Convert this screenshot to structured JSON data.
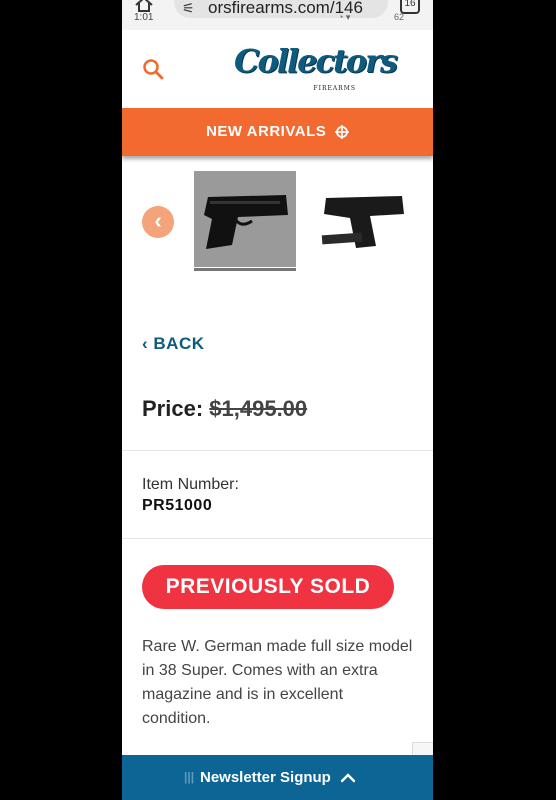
{
  "browser": {
    "url": "orsfirearms.com/146",
    "time": "1:01",
    "tab_count": "16",
    "battery": "62"
  },
  "header": {
    "logo_text": "Collectors",
    "logo_sub": "FIREARMS"
  },
  "nav": {
    "new_arrivals": "NEW ARRIVALS"
  },
  "gallery": {
    "prev_arrow": "‹"
  },
  "product": {
    "back_label": "BACK",
    "price_label": "Price:",
    "price_value": "$1,495.00",
    "item_number_label": "Item Number:",
    "item_number": "PR51000",
    "status": "PREVIOUSLY SOLD",
    "description": "Rare W. German made full size model\nin 38 Super. Comes with an extra\nmagazine and is in excellent\ncondition."
  },
  "footer": {
    "newsletter_label": "Newsletter Signup"
  },
  "colors": {
    "orange": "#f26a2f",
    "brand_blue": "#0f5b7e",
    "sold_red": "#ef3340",
    "footer_blue": "#0c6594"
  }
}
